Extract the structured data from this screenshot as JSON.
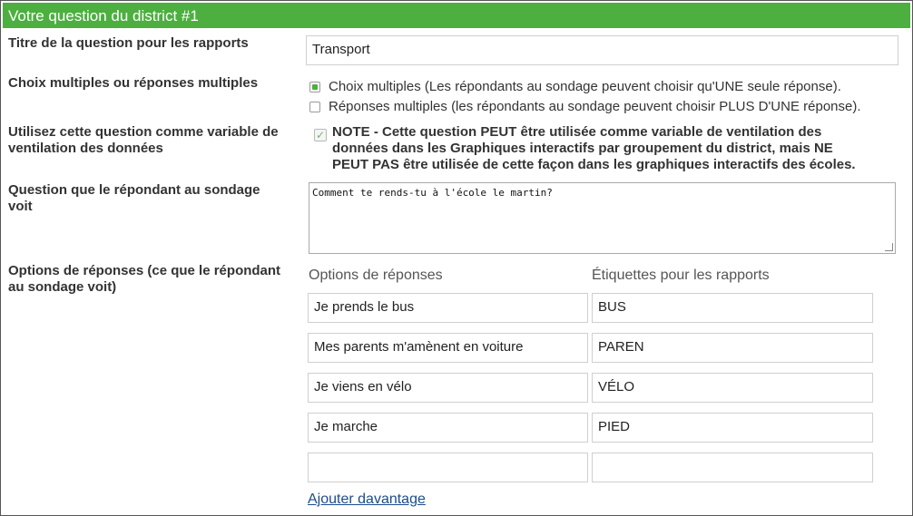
{
  "header": {
    "title": "Votre question du district #1"
  },
  "title_field": {
    "label": "Titre de la question pour les rapports",
    "value": "Transport"
  },
  "choice_type": {
    "label": "Choix multiples ou réponses multiples",
    "options": [
      {
        "label": "Choix multiples (Les répondants au sondage peuvent choisir qu'UNE seule réponse).",
        "checked": true
      },
      {
        "label": "Réponses multiples (les répondants au sondage peuvent choisir PLUS D'UNE réponse).",
        "checked": false
      }
    ]
  },
  "breakdown": {
    "label_line1": "Utilisez cette question comme variable de",
    "label_line2": "ventilation des données",
    "checked": true,
    "note_line1": "NOTE - Cette question PEUT être utilisée comme variable de ventilation des",
    "note_line2": "données dans les Graphiques interactifs par groupement du district, mais NE",
    "note_line3": "PEUT PAS être utilisée de cette façon dans les graphiques interactifs des écoles."
  },
  "question": {
    "label_line1": "Question que le répondant au sondage",
    "label_line2": "voit",
    "value": "Comment te rends-tu à l'école le martin?"
  },
  "answers": {
    "label_line1": "Options de réponses (ce que le répondant",
    "label_line2": "au sondage voit)",
    "col_options": "Options de réponses",
    "col_labels": "Étiquettes pour les rapports",
    "rows": [
      {
        "option": "Je prends le bus",
        "tag": "BUS"
      },
      {
        "option": "Mes parents m'amènent en voiture",
        "tag": "PAREN"
      },
      {
        "option": "Je viens en vélo",
        "tag": "VÉLO"
      },
      {
        "option": "Je marche",
        "tag": "PIED"
      },
      {
        "option": "",
        "tag": ""
      }
    ],
    "add_more": "Ajouter davantage"
  },
  "colors": {
    "header_bg": "#4caf3f",
    "link": "#1a4d8c"
  }
}
